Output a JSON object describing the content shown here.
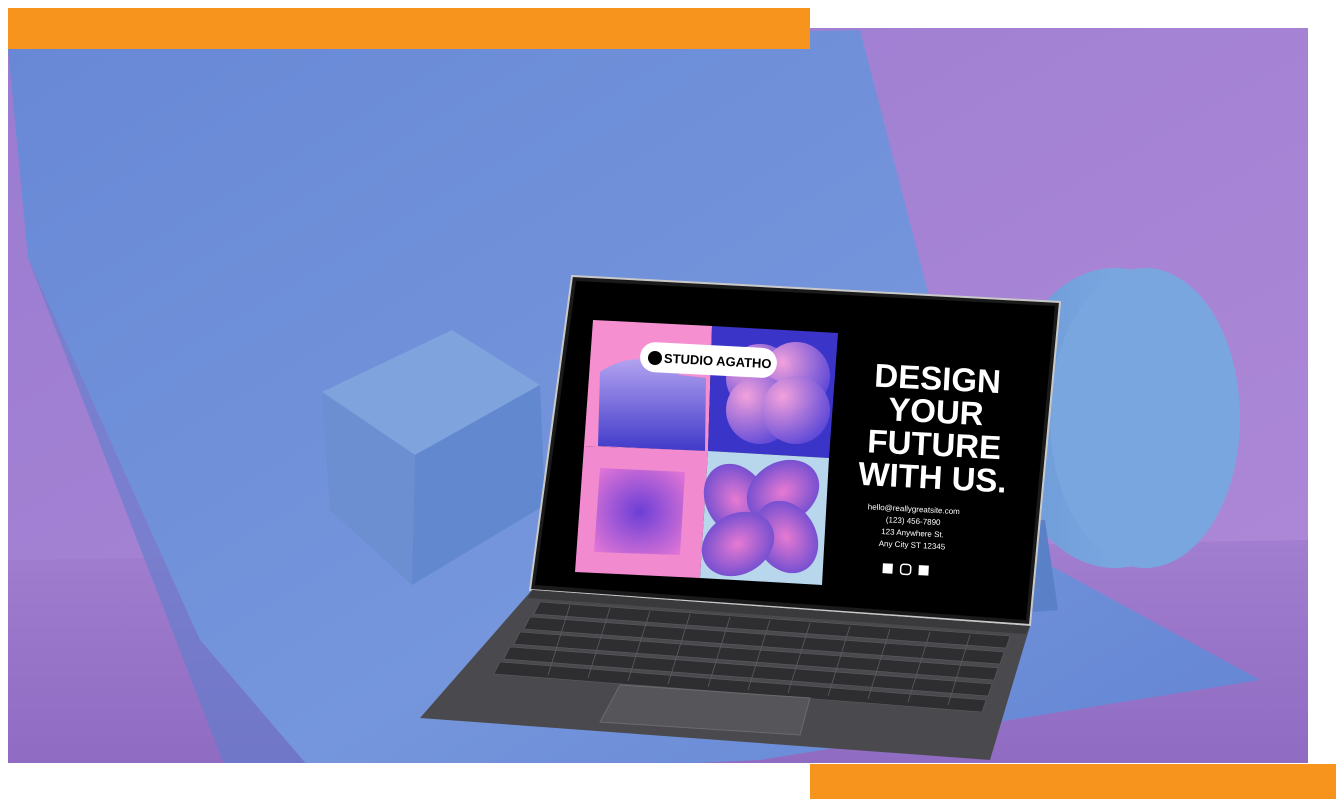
{
  "colors": {
    "accent_orange": "#f7941d",
    "backdrop_purple": "#a785d4",
    "paper_blue": "#6f8ed8",
    "screen_black": "#000000"
  },
  "screen": {
    "brand": "STUDIO AGATHO",
    "headline": [
      "DESIGN",
      "YOUR",
      "FUTURE",
      "WITH US."
    ],
    "contact": {
      "email": "hello@reallygreatsite.com",
      "phone": "(123) 456-7890",
      "address_line1": "123 Anywhere St.",
      "address_line2": "Any City ST 12345"
    },
    "social_icons": [
      "facebook-icon",
      "instagram-icon",
      "twitter-icon"
    ]
  }
}
